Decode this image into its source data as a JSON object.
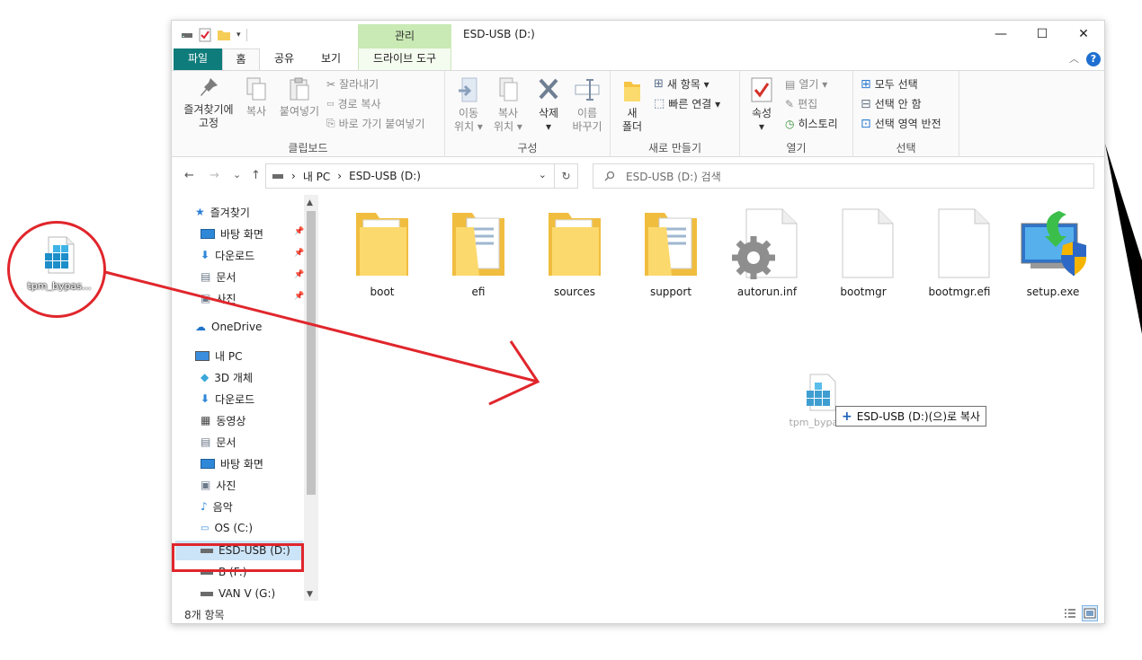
{
  "desktop": {
    "file_label": "tpm_bypas..."
  },
  "window": {
    "title": "ESD-USB (D:)",
    "context_tab_header": "관리",
    "controls": {
      "minimize": "—",
      "maximize": "☐",
      "close": "✕"
    }
  },
  "tabs": {
    "file": "파일",
    "home": "홈",
    "share": "공유",
    "view": "보기",
    "drive_tools": "드라이브 도구",
    "help": "?"
  },
  "ribbon": {
    "clipboard": {
      "label": "클립보드",
      "pin_line1": "즐겨찾기에",
      "pin_line2": "고정",
      "copy": "복사",
      "paste": "붙여넣기",
      "cut": "잘라내기",
      "copy_path": "경로 복사",
      "paste_shortcut": "바로 가기 붙여넣기"
    },
    "organize": {
      "label": "구성",
      "move_line1": "이동",
      "move_line2": "위치 ▾",
      "copyto_line1": "복사",
      "copyto_line2": "위치 ▾",
      "delete": "삭제",
      "delete_arrow": "▾",
      "rename_line1": "이름",
      "rename_line2": "바꾸기"
    },
    "new": {
      "label": "새로 만들기",
      "folder_line1": "새",
      "folder_line2": "폴더",
      "new_item": "새 항목 ▾",
      "easy_access": "빠른 연결 ▾"
    },
    "open": {
      "label": "열기",
      "properties": "속성",
      "properties_arrow": "▾",
      "open": "열기 ▾",
      "edit": "편집",
      "history": "히스토리"
    },
    "select": {
      "label": "선택",
      "select_all": "모두 선택",
      "select_none": "선택 안 함",
      "invert": "선택 영역 반전"
    }
  },
  "address": {
    "back": "←",
    "forward": "→",
    "recent": "⌄",
    "up": "↑",
    "sep": "›",
    "segment1": "내 PC",
    "segment2": "ESD-USB (D:)",
    "dropdown": "⌄",
    "refresh": "↻",
    "search_placeholder": "ESD-USB (D:) 검색"
  },
  "nav": {
    "quick_access": "즐겨찾기",
    "qa_items": [
      {
        "label": "바탕 화면",
        "pin": "📌"
      },
      {
        "label": "다운로드",
        "pin": "📌"
      },
      {
        "label": "문서",
        "pin": "📌"
      },
      {
        "label": "사진",
        "pin": "📌"
      }
    ],
    "onedrive": "OneDrive",
    "this_pc": "내 PC",
    "pc_items": [
      "3D 개체",
      "다운로드",
      "동영상",
      "문서",
      "바탕 화면",
      "사진",
      "음악",
      "OS (C:)",
      "ESD-USB (D:)",
      "B (F:)",
      "VAN V (G:)"
    ],
    "scroll_up": "▲",
    "scroll_down": "▼"
  },
  "files": [
    {
      "name": "boot",
      "icon": "folder-icon"
    },
    {
      "name": "efi",
      "icon": "folder-icon"
    },
    {
      "name": "sources",
      "icon": "folder-icon"
    },
    {
      "name": "support",
      "icon": "folder-icon"
    },
    {
      "name": "autorun.inf",
      "icon": "settings-file-icon"
    },
    {
      "name": "bootmgr",
      "icon": "blank-file-icon"
    },
    {
      "name": "bootmgr.efi",
      "icon": "blank-file-icon"
    },
    {
      "name": "setup.exe",
      "icon": "setup-icon"
    }
  ],
  "drag": {
    "label": "tpm_bypas...",
    "tooltip_plus": "+",
    "tooltip": "ESD-USB (D:)(으)로 복사"
  },
  "status": {
    "count": "8개 항목"
  },
  "colors": {
    "annotation": "#e0262c",
    "file_tab": "#0e7c7b",
    "context_tab": "#c9eab4",
    "selection": "#cce4f7"
  }
}
